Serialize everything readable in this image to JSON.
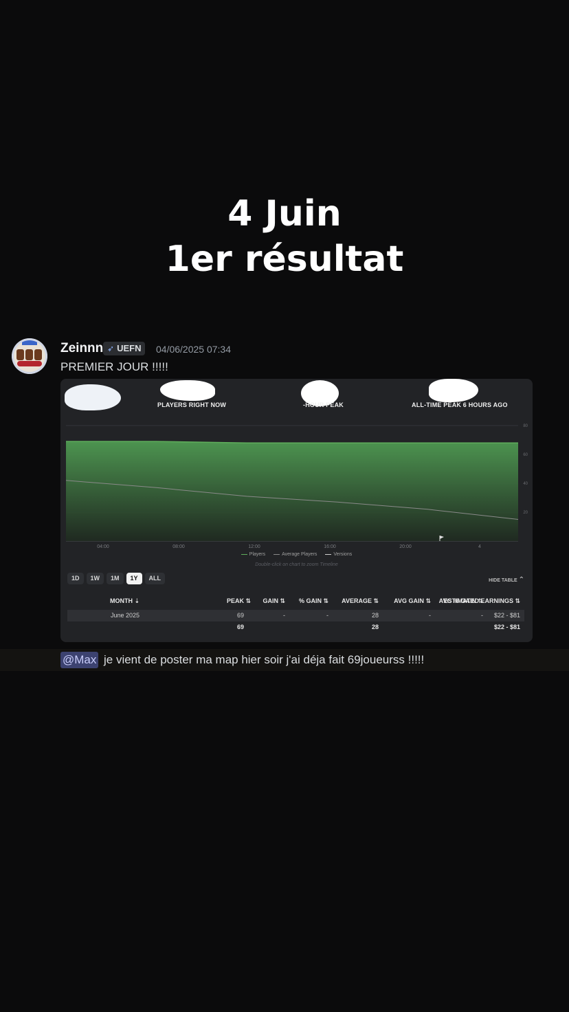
{
  "overlay": {
    "line1": "4 Juin",
    "line2": "1er résultat"
  },
  "message": {
    "username": "Zeinnn",
    "tag": "UEFN",
    "timestamp": "04/06/2025 07:34",
    "text": "PREMIER JOUR !!!!!",
    "reply_mention": "@Max",
    "reply_text": "je vient de poster ma map hier soir j'ai déja fait 69joueurss !!!!!"
  },
  "embed": {
    "stats": [
      {
        "label": "PLAYERS RIGHT NOW"
      },
      {
        "label": "-HOUR PEAK"
      },
      {
        "label": "ALL-TIME PEAK 6 HOURS AGO"
      }
    ],
    "legend": {
      "players": "Players",
      "average": "Average Players",
      "versions": "Versions"
    },
    "hint": "Double-click on chart to zoom Timeline",
    "ranges": [
      "1D",
      "1W",
      "1M",
      "1Y",
      "ALL"
    ],
    "active_range": "1Y",
    "hide_table": "HIDE TABLE",
    "table": {
      "headers": [
        "MONTH",
        "PEAK",
        "GAIN",
        "% GAIN",
        "AVERAGE",
        "AVG GAIN",
        "AVG % GAIN",
        "ESTIMATED EARNINGS"
      ],
      "row": [
        "June 2025",
        "69",
        "-",
        "-",
        "28",
        "-",
        "-",
        "$22 - $81"
      ],
      "total": [
        "",
        "69",
        "",
        "",
        "28",
        "",
        "",
        "$22 - $81"
      ]
    }
  },
  "chart_data": {
    "type": "area",
    "x": [
      "04:00",
      "08:00",
      "12:00",
      "16:00",
      "20:00",
      "4"
    ],
    "ylim": [
      0,
      80
    ],
    "yticks": [
      20,
      40,
      60,
      80
    ],
    "series": [
      {
        "name": "Players",
        "values": [
          69,
          69,
          68,
          68,
          68,
          68
        ]
      },
      {
        "name": "Average Players",
        "values": [
          42,
          37,
          31,
          27,
          22,
          15
        ]
      }
    ],
    "colors": {
      "players": "#5fae5c",
      "average": "#8a8a8a",
      "grid": "#34363a"
    }
  }
}
